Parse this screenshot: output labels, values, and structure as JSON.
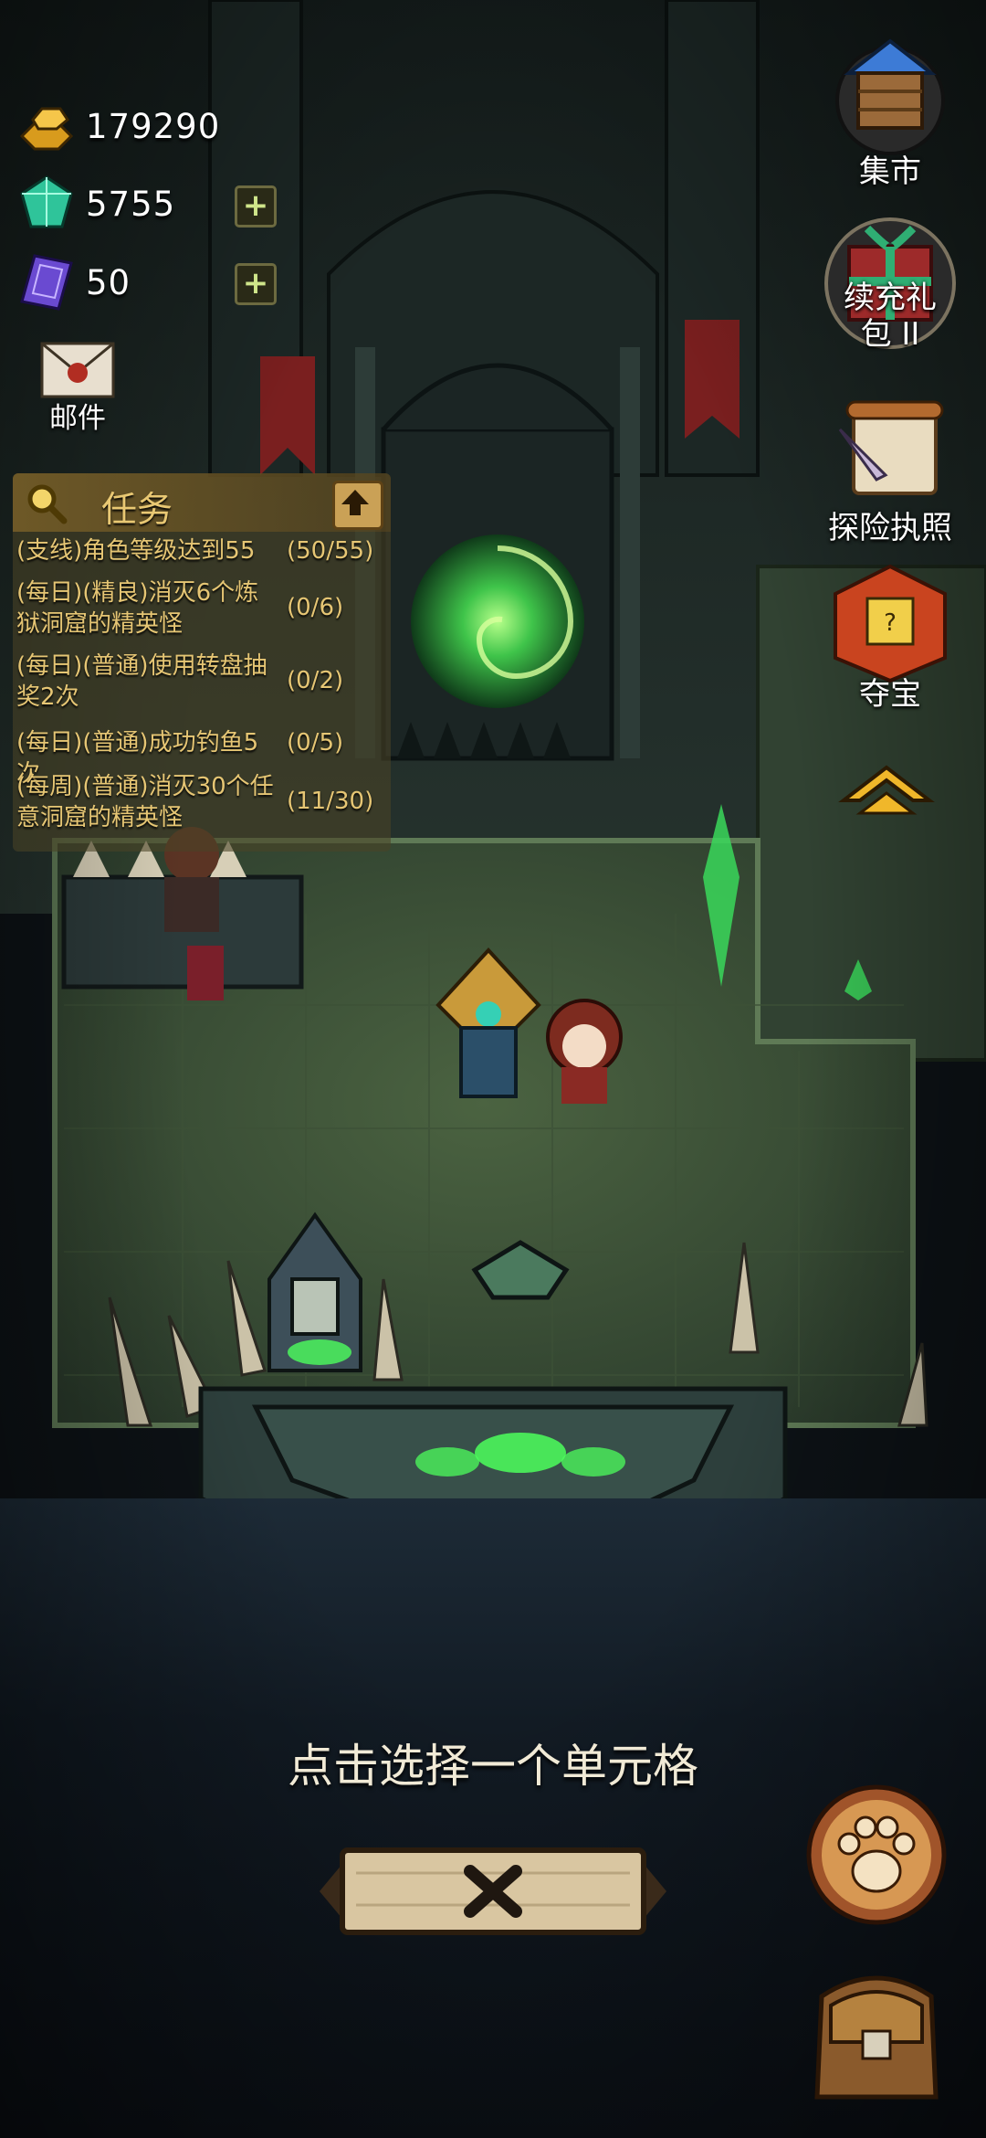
{
  "currency": {
    "gold": {
      "icon": "gold-ingot-icon",
      "value": "179290"
    },
    "gems": {
      "icon": "gem-icon",
      "value": "5755"
    },
    "cards": {
      "icon": "card-icon",
      "value": "50"
    }
  },
  "mail": {
    "label": "邮件",
    "icon": "mail-envelope-icon"
  },
  "quests": {
    "title": "任务",
    "items": [
      {
        "text": "(支线)角色等级达到55",
        "count": "(50/55)"
      },
      {
        "text": "(每日)(精良)消灭6个炼狱洞窟的精英怪",
        "count": "(0/6)"
      },
      {
        "text": "(每日)(普通)使用转盘抽奖2次",
        "count": "(0/2)"
      },
      {
        "text": "(每日)(普通)成功钓鱼5次",
        "count": "(0/5)"
      },
      {
        "text": "(每周)(普通)消灭30个任意洞窟的精英怪",
        "count": "(11/30)"
      }
    ]
  },
  "right_menu": {
    "market": "集市",
    "gift_line1": "续充礼",
    "gift_line2": "包 II",
    "license": "探险执照",
    "treasure": "夺宝"
  },
  "hint": "点击选择一个单元格",
  "colors": {
    "accent_gold": "#e6c674",
    "floor_green": "#3b5236",
    "portal_green": "#3fbf4a"
  }
}
